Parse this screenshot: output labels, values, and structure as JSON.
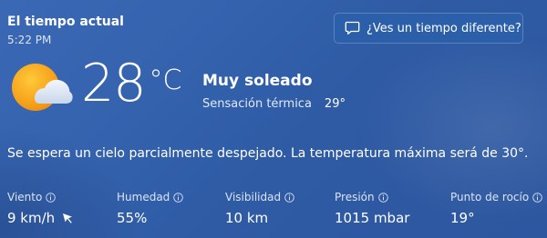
{
  "header": {
    "title": "El tiempo actual",
    "time": "5:22 PM",
    "different_weather_button": "¿Ves un tiempo diferente?"
  },
  "current": {
    "icon": "partly-sunny-icon",
    "temperature": "28",
    "unit": "°C",
    "condition": "Muy soleado",
    "feels_like_label": "Sensación térmica",
    "feels_like_value": "29°"
  },
  "summary": "Se espera un cielo parcialmente despejado. La temperatura máxima será de 30°.",
  "details": [
    {
      "label": "Viento",
      "value": "9 km/h"
    },
    {
      "label": "Humedad",
      "value": "55%"
    },
    {
      "label": "Visibilidad",
      "value": "10 km"
    },
    {
      "label": "Presión",
      "value": "1015 mbar"
    },
    {
      "label": "Punto de rocío",
      "value": "19°"
    }
  ],
  "colors": {
    "background": "#3563ae",
    "button_background": "#2c5fa9",
    "sun": "#f6a21a",
    "text": "#ffffff"
  }
}
